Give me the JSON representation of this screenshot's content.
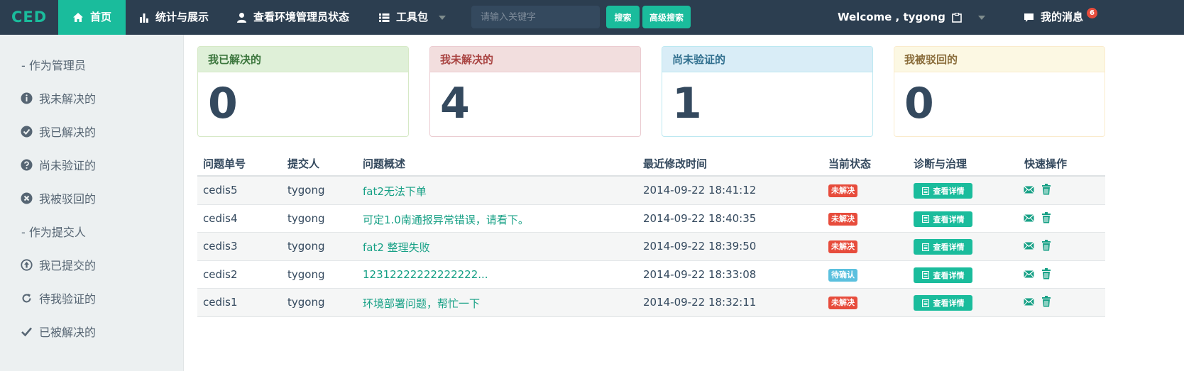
{
  "navbar": {
    "brand": "CED",
    "items": [
      {
        "label": "首页",
        "icon": "home-icon"
      },
      {
        "label": "统计与展示",
        "icon": "bar-chart-icon"
      },
      {
        "label": "查看环境管理员状态",
        "icon": "user-icon"
      },
      {
        "label": "工具包",
        "icon": "list-icon"
      }
    ],
    "search_placeholder": "请输入关键字",
    "search_button": "搜索",
    "advanced_search_button": "高级搜索",
    "welcome": "Welcome , tygong",
    "messages_label": "我的消息",
    "messages_count": "6"
  },
  "sidebar": {
    "admin_header": "- 作为管理员",
    "admin_items": [
      {
        "label": "我未解决的",
        "icon": "info-circle-icon"
      },
      {
        "label": "我已解决的",
        "icon": "check-circle-icon"
      },
      {
        "label": "尚未验证的",
        "icon": "question-circle-icon"
      },
      {
        "label": "我被驳回的",
        "icon": "remove-circle-icon"
      }
    ],
    "submitter_header": "- 作为提交人",
    "submitter_items": [
      {
        "label": "我已提交的",
        "icon": "upload-circle-icon"
      },
      {
        "label": "待我验证的",
        "icon": "refresh-icon"
      },
      {
        "label": "已被解决的",
        "icon": "check-icon"
      }
    ]
  },
  "cards": [
    {
      "title": "我已解决的",
      "value": "0",
      "color": "#3c763d",
      "head_bg": "#dff0d8",
      "border": "#d6e9c6"
    },
    {
      "title": "我未解决的",
      "value": "4",
      "color": "#a94442",
      "head_bg": "#f2dede",
      "border": "#ebccd1"
    },
    {
      "title": "尚未验证的",
      "value": "1",
      "color": "#31708f",
      "head_bg": "#d9edf7",
      "border": "#bce8f1"
    },
    {
      "title": "我被驳回的",
      "value": "0",
      "color": "#8a6d3b",
      "head_bg": "#fcf8e3",
      "border": "#faebcc"
    }
  ],
  "table": {
    "headers": [
      "问题单号",
      "提交人",
      "问题概述",
      "最近修改时间",
      "当前状态",
      "诊断与治理",
      "快速操作"
    ],
    "detail_label": "查看详情",
    "rows": [
      {
        "id": "cedis5",
        "submitter": "tygong",
        "summary": "fat2无法下单",
        "time": "2014-09-22 18:41:12",
        "status": "未解决",
        "status_color": "#e74c3c"
      },
      {
        "id": "cedis4",
        "submitter": "tygong",
        "summary": "可定1.0南通报异常错误，请看下。",
        "time": "2014-09-22 18:40:35",
        "status": "未解决",
        "status_color": "#e74c3c"
      },
      {
        "id": "cedis3",
        "submitter": "tygong",
        "summary": "fat2 整理失败",
        "time": "2014-09-22 18:39:50",
        "status": "未解决",
        "status_color": "#e74c3c"
      },
      {
        "id": "cedis2",
        "submitter": "tygong",
        "summary": "12312222222222222...",
        "time": "2014-09-22 18:33:08",
        "status": "待确认",
        "status_color": "#5bc0de"
      },
      {
        "id": "cedis1",
        "submitter": "tygong",
        "summary": "环境部署问题，帮忙一下",
        "time": "2014-09-22 18:32:11",
        "status": "未解决",
        "status_color": "#e74c3c"
      }
    ]
  }
}
